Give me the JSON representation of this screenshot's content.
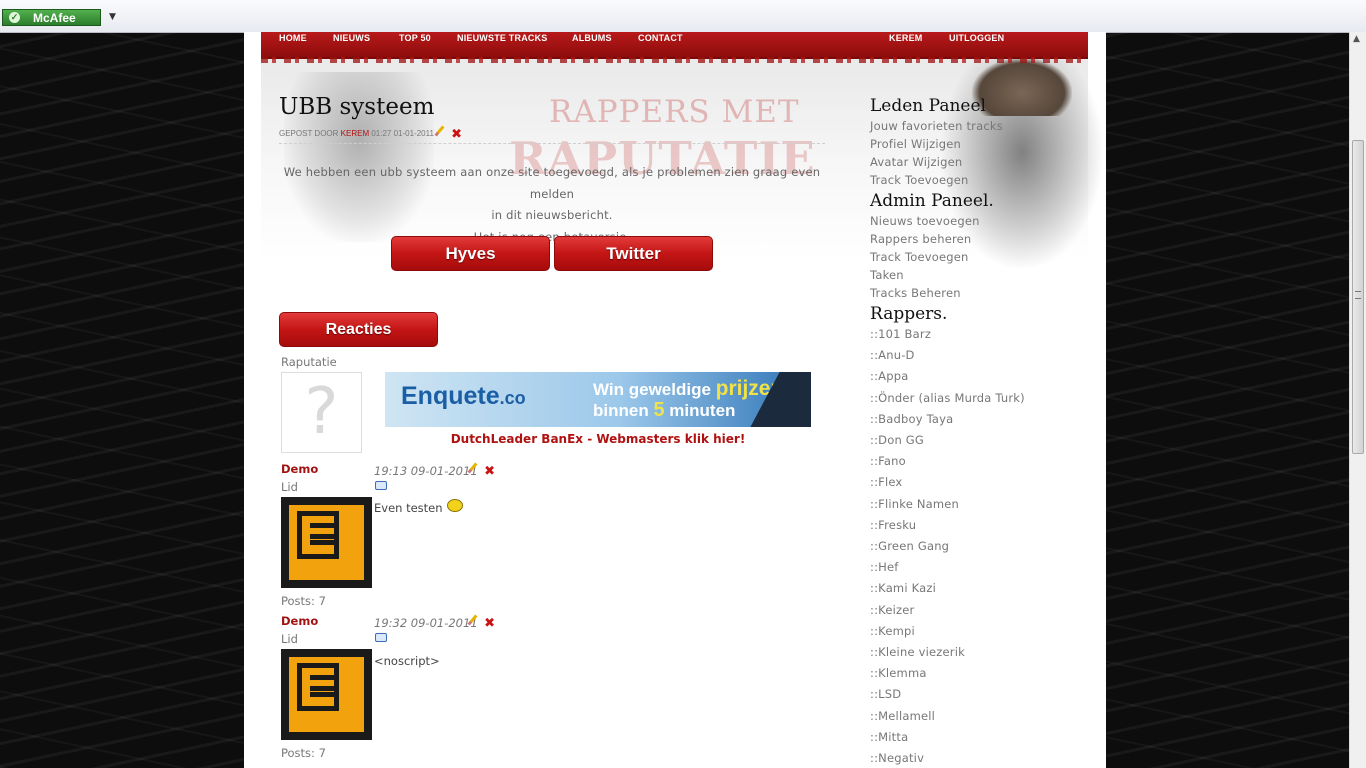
{
  "toolbar": {
    "mcafee_label": "McAfee",
    "dropdown_icon": "chevron-down-icon"
  },
  "nav": {
    "items": [
      "HOME",
      "NIEUWS",
      "TOP 50",
      "NIEUWSTE TRACKS",
      "ALBUMS",
      "CONTACT"
    ],
    "user": "KEREM",
    "logout": "UITLOGGEN"
  },
  "header": {
    "watermark_line1": "RAPPERS MET",
    "watermark_line2": "RAPUTATIE"
  },
  "post": {
    "title": "UBB systeem",
    "meta_prefix": "GEPOST DOOR",
    "author": "KEREM",
    "datetime": "01:27 01-01-2011",
    "body_line1": "We hebben een ubb systeem aan onze site toegevoegd, als je problemen zien graag even melden",
    "body_line2": "in dit nieuwsbericht.",
    "body_line3": "Het is nog een betaversie.",
    "share_hyves": "Hyves",
    "share_twitter": "Twitter"
  },
  "comments_section": {
    "header": "Reacties",
    "guest_label": "Raputatie",
    "guest_avatar_char": "?"
  },
  "banner": {
    "logo_main": "Enquete",
    "logo_suffix": ".co",
    "tagline1_a": "Win geweldige ",
    "tagline1_b": "prijzen",
    "tagline2_a": "binnen ",
    "tagline2_b": "5",
    "tagline2_c": " minuten",
    "link": "DutchLeader BanEx - Webmasters klik hier!"
  },
  "comments": [
    {
      "name": "Demo",
      "role": "Lid",
      "time": "19:13 09-01-2011",
      "text": "Even testen",
      "posts": "Posts: 7"
    },
    {
      "name": "Demo",
      "role": "Lid",
      "time": "19:32 09-01-2011",
      "text": "<noscript>",
      "posts": "Posts: 7"
    }
  ],
  "sidebar": {
    "leden_title": "Leden Paneel",
    "leden_links": [
      "Jouw favorieten tracks",
      "Profiel Wijzigen",
      "Avatar Wijzigen",
      "Track Toevoegen"
    ],
    "admin_title": "Admin Paneel.",
    "admin_links": [
      "Nieuws toevoegen",
      "Rappers beheren",
      "Track Toevoegen",
      "Taken",
      "Tracks Beheren"
    ],
    "rappers_title": "Rappers.",
    "rappers": [
      "::101 Barz",
      "::Anu-D",
      "::Appa",
      "::Önder (alias Murda Turk)",
      "::Badboy Taya",
      "::Don GG",
      "::Fano",
      "::Flex",
      "::Flinke Namen",
      "::Fresku",
      "::Green Gang",
      "::Hef",
      "::Kami Kazi",
      "::Keizer",
      "::Kempi",
      "::Kleine viezerik",
      "::Klemma",
      "::LSD",
      "::Mellamell",
      "::Mitta",
      "::Negativ"
    ]
  }
}
